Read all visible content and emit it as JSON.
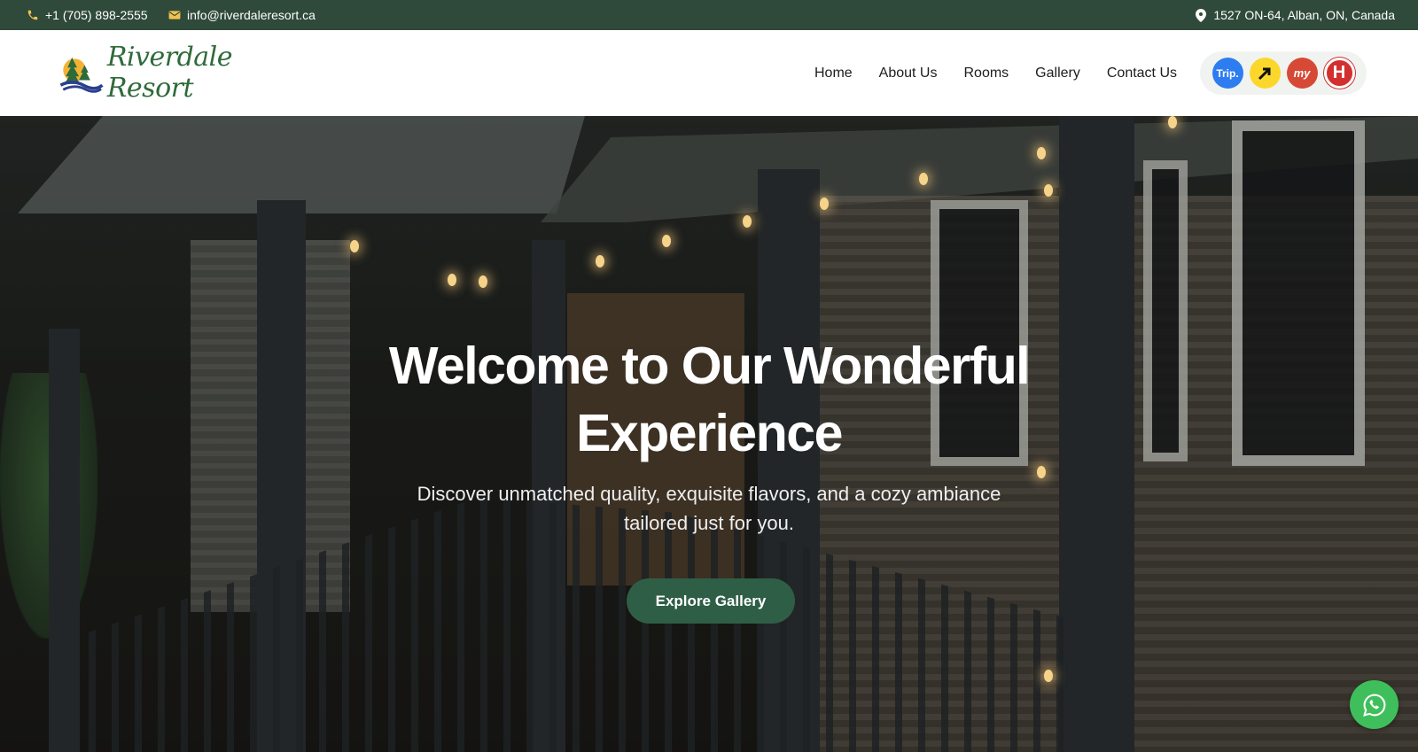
{
  "topbar": {
    "phone": "+1 (705) 898-2555",
    "email": "info@riverdaleresort.ca",
    "address": "1527 ON-64, Alban, ON, Canada",
    "icons": {
      "phone": "phone-icon",
      "email": "mail-icon",
      "address": "map-pin-icon"
    },
    "background": "#2f4a3a",
    "icon_color": "#f2c14e"
  },
  "header": {
    "logo_text": "Riverdale Resort",
    "nav": [
      "Home",
      "About Us",
      "Rooms",
      "Gallery",
      "Contact Us"
    ],
    "partners": [
      {
        "name": "trip-com",
        "label": "Trip."
      },
      {
        "name": "expedia",
        "label": ""
      },
      {
        "name": "makemytrip",
        "label": "my"
      },
      {
        "name": "hotels-com",
        "label": "H"
      }
    ]
  },
  "hero": {
    "title_line1": "Welcome to Our Wonderful",
    "title_line2": "Experience",
    "subtitle_line1": "Discover unmatched quality, exquisite flavors, and a cozy ambiance",
    "subtitle_line2": "tailored just for you.",
    "cta": "Explore Gallery",
    "accent": "#2f5e46"
  },
  "floating": {
    "whatsapp_icon": "whatsapp-icon",
    "color": "#3fbf5b"
  }
}
